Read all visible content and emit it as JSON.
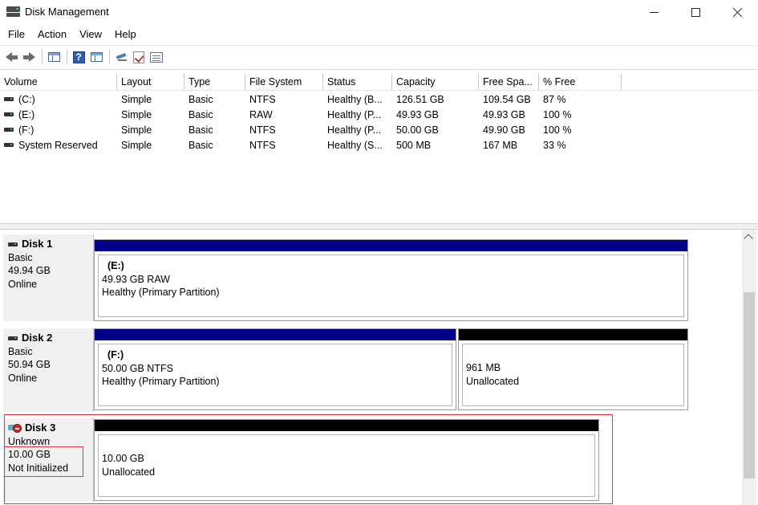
{
  "window": {
    "title": "Disk Management",
    "icon": "disk-management-icon"
  },
  "menu": [
    "File",
    "Action",
    "View",
    "Help"
  ],
  "toolbar": {
    "buttons": [
      "back-icon",
      "forward-icon",
      "console-tree-icon",
      "help-icon",
      "show-hide-icon",
      "connect-icon",
      "check-icon",
      "properties-icon"
    ]
  },
  "volumes": {
    "columns": [
      "Volume",
      "Layout",
      "Type",
      "File System",
      "Status",
      "Capacity",
      "Free Spa...",
      "% Free"
    ],
    "rows": [
      {
        "volume": "(C:)",
        "layout": "Simple",
        "type": "Basic",
        "fs": "NTFS",
        "status": "Healthy (B...",
        "capacity": "126.51 GB",
        "free": "109.54 GB",
        "pct": "87 %"
      },
      {
        "volume": "(E:)",
        "layout": "Simple",
        "type": "Basic",
        "fs": "RAW",
        "status": "Healthy (P...",
        "capacity": "49.93 GB",
        "free": "49.93 GB",
        "pct": "100 %"
      },
      {
        "volume": "(F:)",
        "layout": "Simple",
        "type": "Basic",
        "fs": "NTFS",
        "status": "Healthy (P...",
        "capacity": "50.00 GB",
        "free": "49.90 GB",
        "pct": "100 %"
      },
      {
        "volume": "System Reserved",
        "layout": "Simple",
        "type": "Basic",
        "fs": "NTFS",
        "status": "Healthy (S...",
        "capacity": "500 MB",
        "free": "167 MB",
        "pct": "33 %"
      }
    ]
  },
  "disks": [
    {
      "name": "Disk 1",
      "type": "Basic",
      "size": "49.94 GB",
      "state": "Online",
      "partitions": [
        {
          "title": "(E:)",
          "line1": "49.93 GB RAW",
          "line2": "Healthy (Primary Partition)",
          "color": "#00008b"
        }
      ]
    },
    {
      "name": "Disk 2",
      "type": "Basic",
      "size": "50.94 GB",
      "state": "Online",
      "partitions": [
        {
          "title": "(F:)",
          "line1": "50.00 GB NTFS",
          "line2": "Healthy (Primary Partition)",
          "color": "#00008b"
        },
        {
          "title": "",
          "line1": "961 MB",
          "line2": "Unallocated",
          "color": "#000000"
        }
      ]
    },
    {
      "name": "Disk 3",
      "type": "Unknown",
      "size": "10.00 GB",
      "state": "Not Initialized",
      "partitions": [
        {
          "title": "",
          "line1": "10.00 GB",
          "line2": "Unallocated",
          "color": "#000000"
        }
      ]
    }
  ],
  "colors": {
    "primary_partition": "#00008b",
    "unallocated": "#000000",
    "highlight": "#e0373d"
  }
}
